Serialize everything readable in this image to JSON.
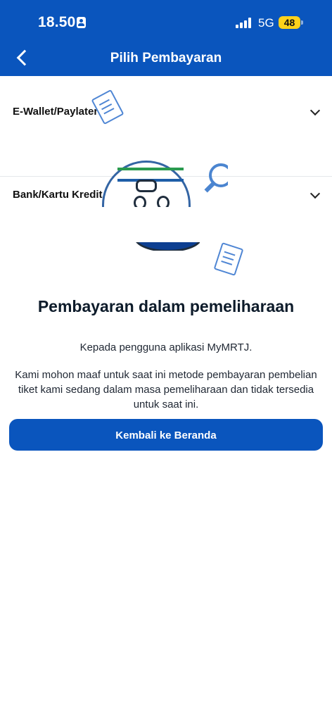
{
  "status_bar": {
    "time": "18.50",
    "network": "5G",
    "battery": "48"
  },
  "header": {
    "title": "Pilih Pembayaran"
  },
  "payment_methods": [
    {
      "label": "E-Wallet/Paylater"
    },
    {
      "label": "Bank/Kartu Kredit"
    }
  ],
  "maintenance": {
    "title": "Pembayaran dalam pemeliharaan",
    "greeting": "Kepada pengguna aplikasi MyMRTJ.",
    "message": "Kami mohon maaf untuk saat ini metode pembayaran pembelian tiket kami sedang dalam masa pemeliharaan dan tidak tersedia untuk saat ini.",
    "button_label": "Kembali ke Beranda"
  },
  "colors": {
    "primary": "#0a55bd",
    "battery": "#ffd21a"
  }
}
